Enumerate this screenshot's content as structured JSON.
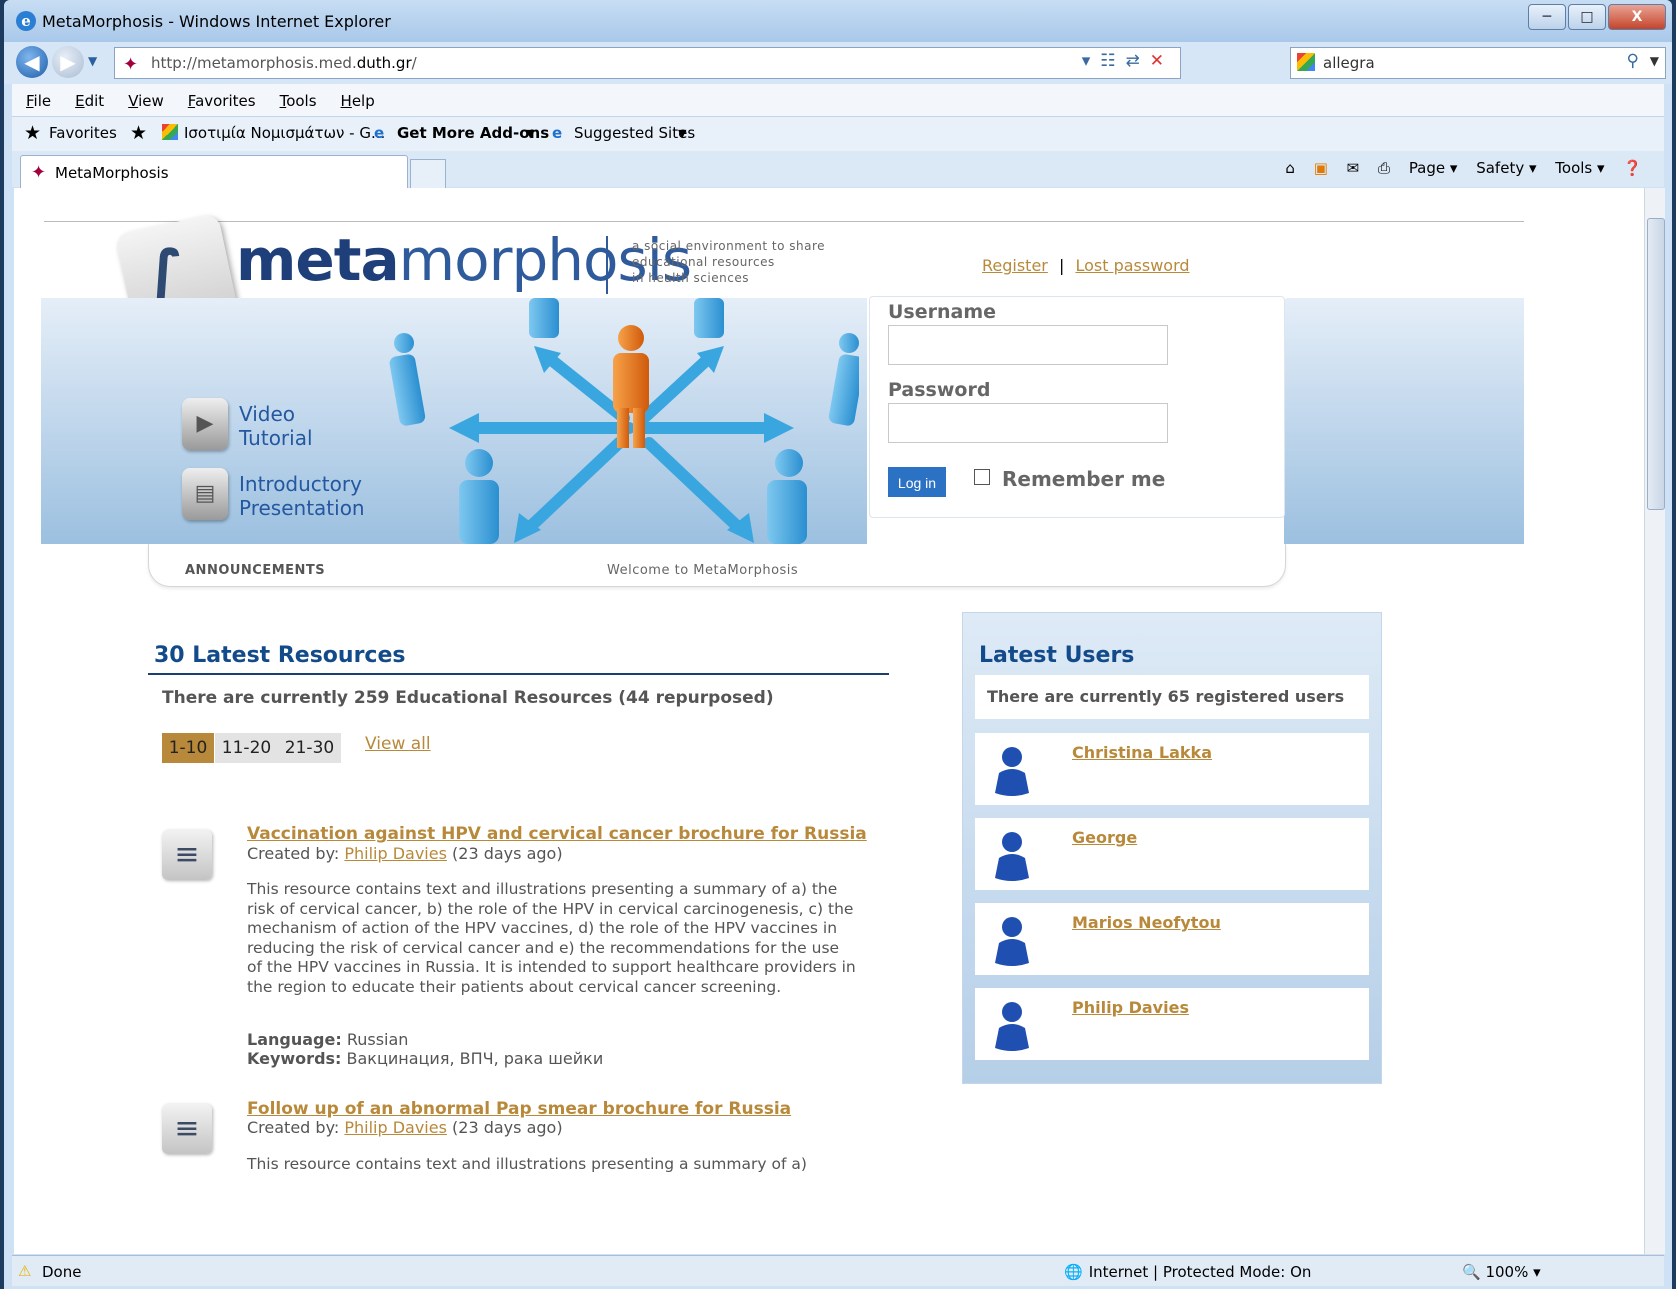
{
  "window": {
    "title": "MetaMorphosis - Windows Internet Explorer",
    "min": "─",
    "max": "□",
    "close": "X"
  },
  "address": {
    "url_prefix": "http://metamorphosis.med.",
    "url_domain": "duth.gr",
    "url_suffix": "/",
    "search_value": "allegra"
  },
  "menu": [
    "File",
    "Edit",
    "View",
    "Favorites",
    "Tools",
    "Help"
  ],
  "favorites": {
    "favorites_label": "Favorites",
    "item1": "Ισοτιμία Νομισμάτων - G...",
    "item2": "Get More Add-ons",
    "item3": "Suggested Sites"
  },
  "tab": {
    "label": "MetaMorphosis"
  },
  "commandbar": {
    "page": "Page",
    "safety": "Safety",
    "tools": "Tools"
  },
  "status": {
    "text": "Done",
    "zone": "Internet | Protected Mode: On",
    "zoom": "100%"
  },
  "site": {
    "logo_meta": "meta",
    "logo_rest": "morphosis",
    "tagline": "a social environment to share\neducational resources\nin health sciences",
    "register": "Register",
    "separator": "|",
    "lost_password": "Lost password",
    "username_label": "Username",
    "password_label": "Password",
    "login_button": "Log in",
    "remember_label": "Remember me",
    "video_tutorial": "Video\nTutorial",
    "intro_presentation": "Introductory\nPresentation",
    "announcements": "ANNOUNCEMENTS",
    "welcome": "Welcome to MetaMorphosis"
  },
  "resources": {
    "title": "30 Latest Resources",
    "count_text": "There are currently 259 Educational Resources (44 repurposed)",
    "pages": [
      "1-10",
      "11-20",
      "21-30"
    ],
    "view_all": "View all",
    "items": [
      {
        "title": "Vaccination against HPV and cervical cancer brochure for Russia",
        "created_prefix": "Created by: ",
        "author": "Philip Davies",
        "age": " (23 days ago)",
        "description": "This resource contains text and illustrations presenting a summary of a) the risk of cervical cancer, b) the role of the HPV in cervical carcinogenesis, c) the mechanism of action of the HPV vaccines, d) the role of the HPV vaccines in reducing the risk of cervical cancer and e) the recommendations for the use of the HPV vaccines in Russia. It is intended to support healthcare providers in the region to educate their patients about cervical cancer screening.",
        "language_label": "Language:",
        "language": " Russian",
        "keywords_label": "Keywords:",
        "keywords": " Вакцинация, ВПЧ, рака шейки"
      },
      {
        "title": "Follow up of an abnormal Pap smear brochure for Russia",
        "created_prefix": "Created by: ",
        "author": "Philip Davies",
        "age": " (23 days ago)",
        "description": "This resource contains text and illustrations presenting a summary of a)"
      }
    ]
  },
  "users": {
    "title": "Latest Users",
    "count_text": "There are currently 65 registered users",
    "list": [
      "Christina Lakka",
      "George",
      "Marios Neofytou",
      "Philip Davies"
    ]
  }
}
